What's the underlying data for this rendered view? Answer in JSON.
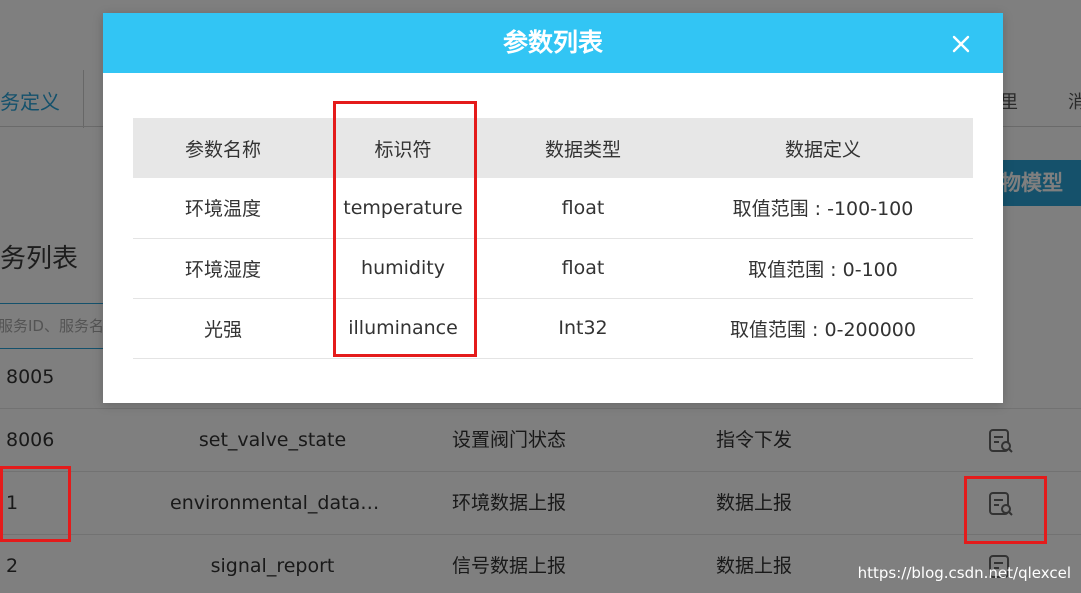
{
  "background": {
    "tab_active_label": "务定义",
    "right_tabs": [
      "里",
      "消"
    ],
    "thing_model_button": "物模型",
    "list_heading": "务列表",
    "search_placeholder": "服务ID、服务名",
    "rows": [
      {
        "id": "8005",
        "name": "",
        "desc": "",
        "type": ""
      },
      {
        "id": "8006",
        "name": "set_valve_state",
        "desc": "设置阀门状态",
        "type": "指令下发"
      },
      {
        "id": "1",
        "name": "environmental_data…",
        "desc": "环境数据上报",
        "type": "数据上报"
      },
      {
        "id": "2",
        "name": "signal_report",
        "desc": "信号数据上报",
        "type": "数据上报"
      }
    ]
  },
  "watermark": "https://blog.csdn.net/qlexcel",
  "modal": {
    "title": "参数列表",
    "columns": [
      "参数名称",
      "标识符",
      "数据类型",
      "数据定义"
    ],
    "rows": [
      [
        "环境温度",
        "temperature",
        "float",
        "取值范围 : -100-100"
      ],
      [
        "环境湿度",
        "humidity",
        "float",
        "取值范围 : 0-100"
      ],
      [
        "光强",
        "illuminance",
        "Int32",
        "取值范围 : 0-200000"
      ]
    ]
  },
  "colors": {
    "header": "#32c5f4",
    "accent": "#29a3d9",
    "highlight_box": "#e41b1b"
  },
  "icons": {
    "close": "close-icon",
    "detail": "view-detail-icon"
  }
}
